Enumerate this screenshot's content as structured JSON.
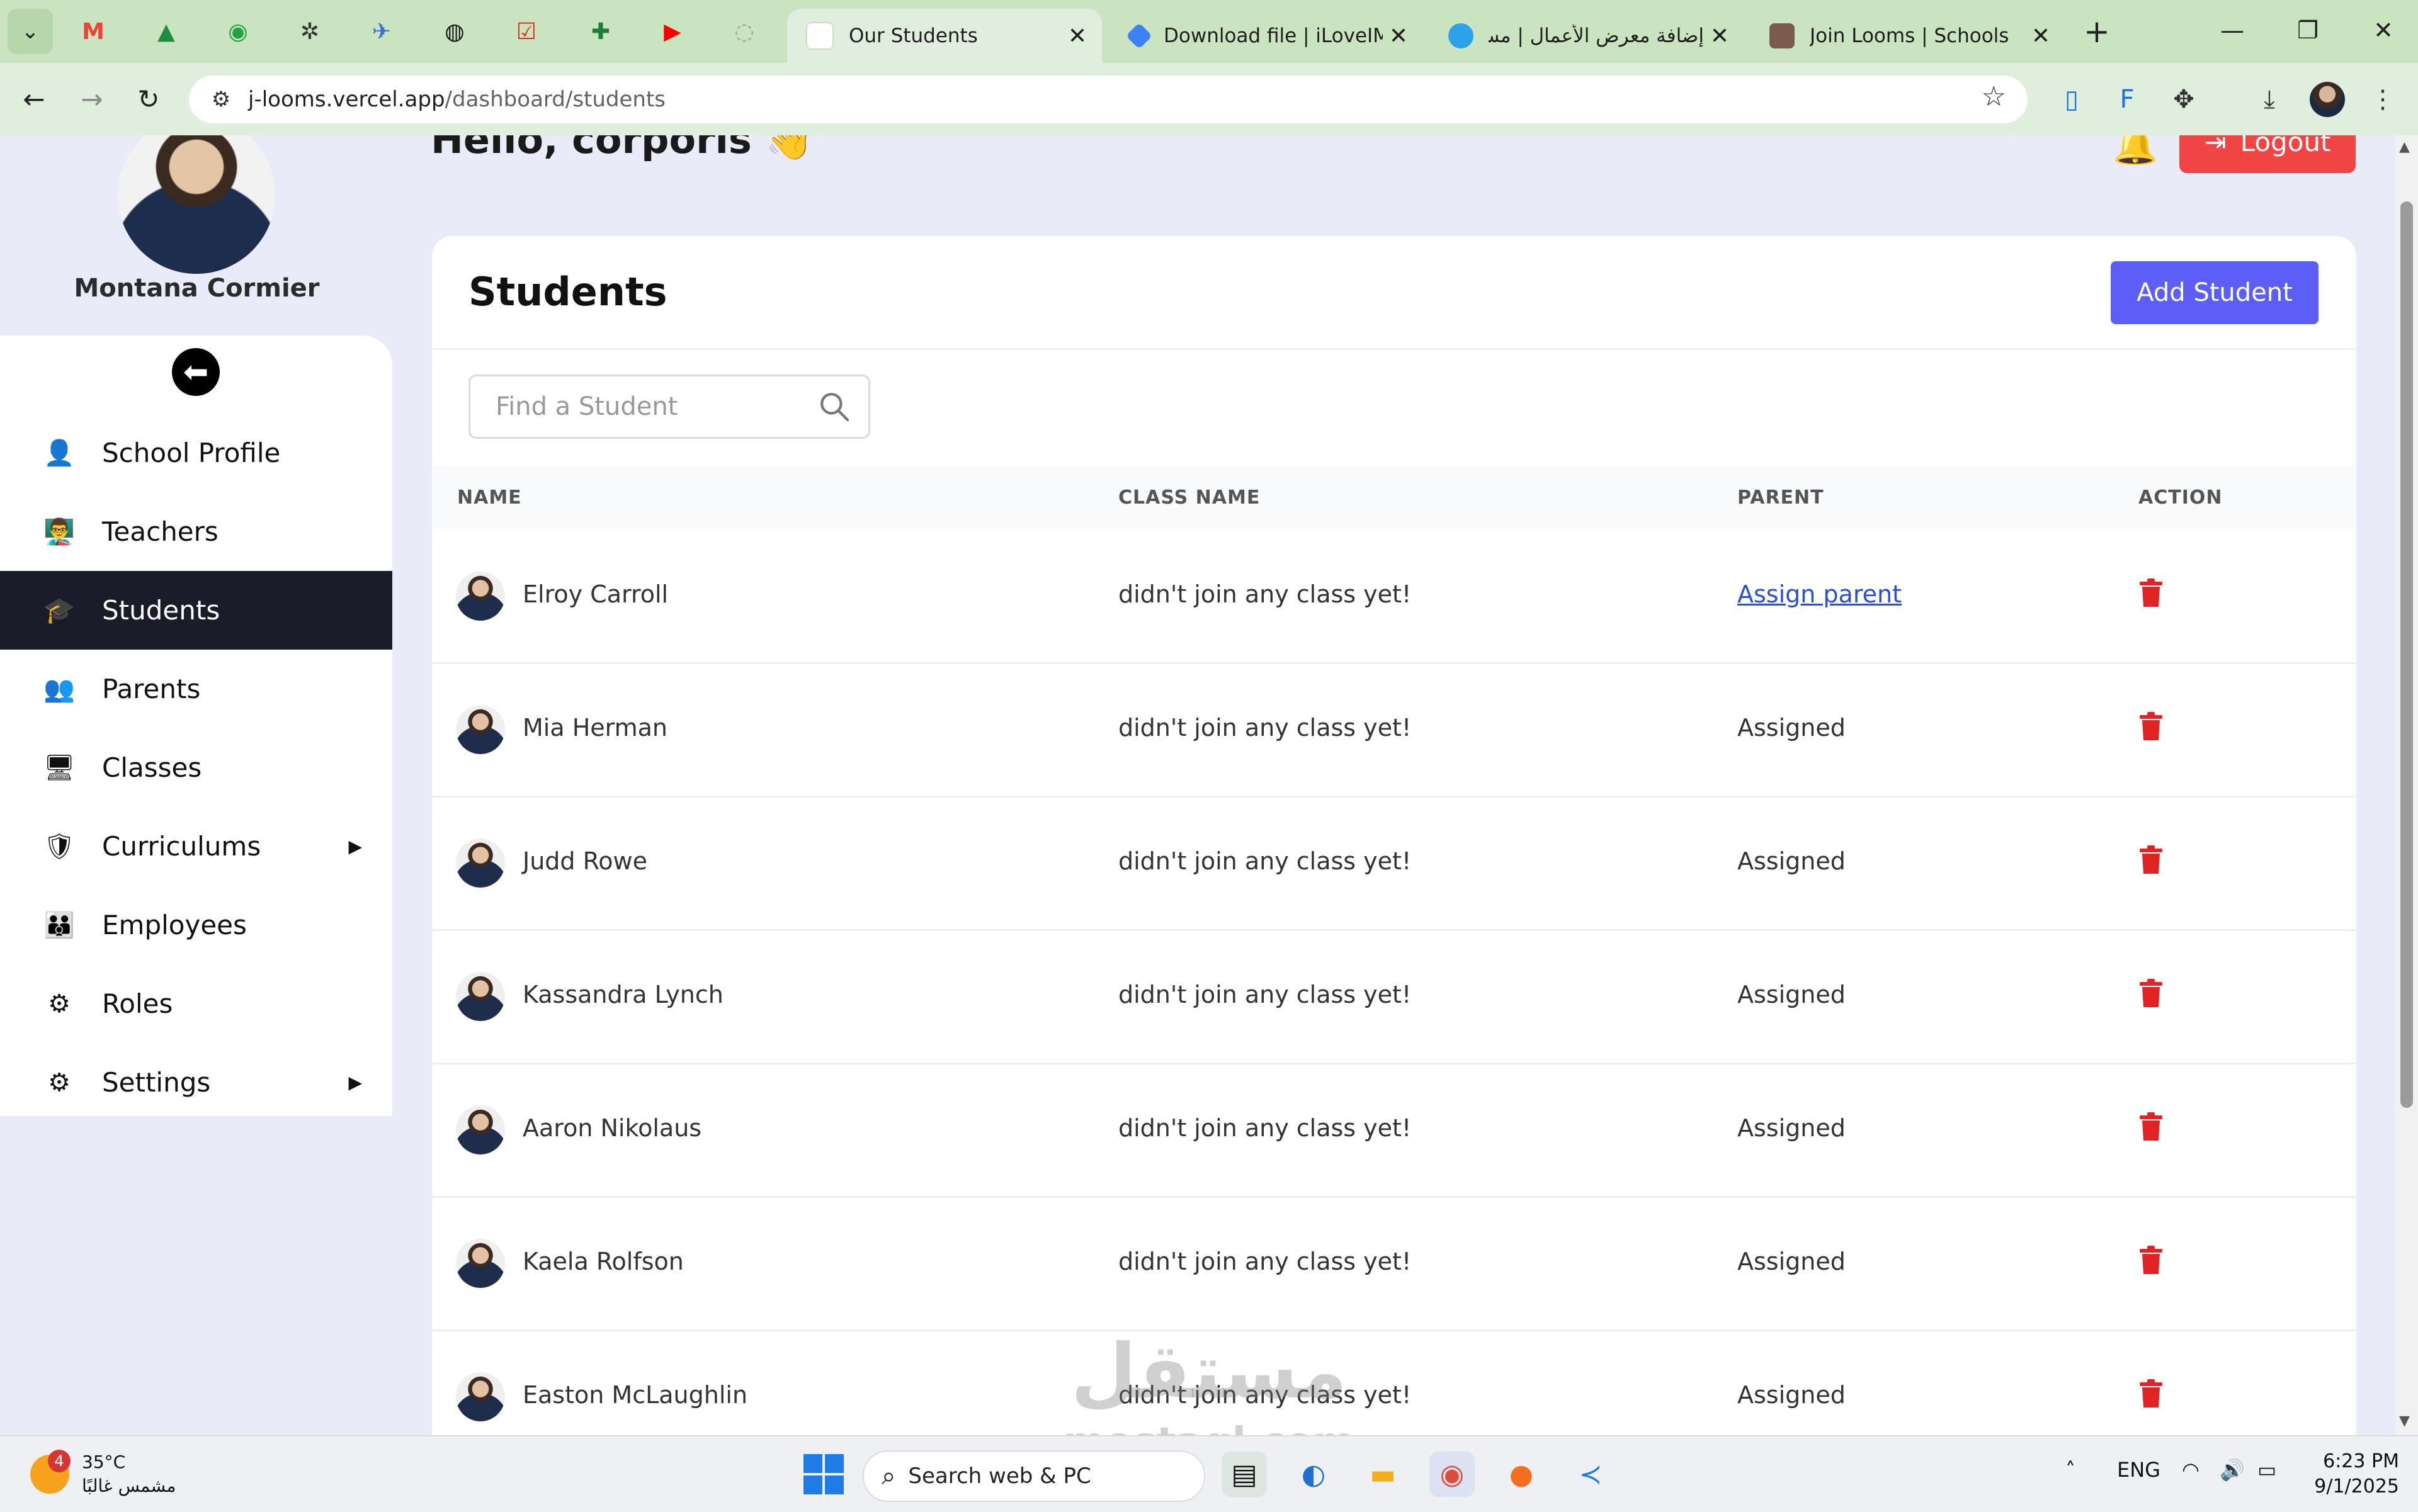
{
  "browser": {
    "tabs": [
      {
        "title": "Our Students",
        "active": true
      },
      {
        "title": "Download file | iLoveIMG",
        "active": false
      },
      {
        "title": "إضافة معرض الأعمال | مس",
        "active": false
      },
      {
        "title": "Join Looms | Schools",
        "active": false
      }
    ],
    "new_tab": "+",
    "url_host": "j-looms.vercel.app",
    "url_path": "/dashboard/students"
  },
  "user": {
    "name": "Montana Cormier",
    "greeting": "Hello, corporis 👋",
    "logout_label": "Logout"
  },
  "sidebar": {
    "items": [
      {
        "label": "School Profile",
        "icon": "person-icon",
        "glyph": "👤"
      },
      {
        "label": "Teachers",
        "icon": "chalkboard-teacher-icon",
        "glyph": "👨‍🏫"
      },
      {
        "label": "Students",
        "icon": "graduation-cap-icon",
        "glyph": "🎓"
      },
      {
        "label": "Parents",
        "icon": "people-icon",
        "glyph": "👥"
      },
      {
        "label": "Classes",
        "icon": "classroom-icon",
        "glyph": "🖥"
      },
      {
        "label": "Curriculums",
        "icon": "shield-icon",
        "glyph": "🛡"
      },
      {
        "label": "Employees",
        "icon": "users-icon",
        "glyph": "👪"
      },
      {
        "label": "Roles",
        "icon": "user-gear-icon",
        "glyph": "⚙"
      },
      {
        "label": "Settings",
        "icon": "gear-icon",
        "glyph": "⚙"
      }
    ],
    "active": "Students"
  },
  "students_card": {
    "title": "Students",
    "add_label": "Add Student",
    "search_placeholder": "Find a Student",
    "columns": [
      "NAME",
      "CLASS NAME",
      "PARENT",
      "ACTION"
    ],
    "rows": [
      {
        "name": "Elroy Carroll",
        "class": "didn't join any class yet!",
        "parent": "Assign parent",
        "link": true
      },
      {
        "name": "Mia Herman",
        "class": "didn't join any class yet!",
        "parent": "Assigned",
        "link": false
      },
      {
        "name": "Judd Rowe",
        "class": "didn't join any class yet!",
        "parent": "Assigned",
        "link": false
      },
      {
        "name": "Kassandra Lynch",
        "class": "didn't join any class yet!",
        "parent": "Assigned",
        "link": false
      },
      {
        "name": "Aaron Nikolaus",
        "class": "didn't join any class yet!",
        "parent": "Assigned",
        "link": false
      },
      {
        "name": "Kaela Rolfson",
        "class": "didn't join any class yet!",
        "parent": "Assigned",
        "link": false
      },
      {
        "name": "Easton McLaughlin",
        "class": "didn't join any class yet!",
        "parent": "Assigned",
        "link": false
      }
    ]
  },
  "watermark": {
    "line1": "مستقل",
    "line2": "mostaql.com"
  },
  "taskbar": {
    "weather_temp": "35°C",
    "weather_desc": "مشمس غالبًا",
    "weather_badge": "4",
    "search_label": "Search web & PC",
    "language": "ENG",
    "time": "6:23 PM",
    "date": "9/1/2025"
  },
  "colors": {
    "accent": "#5b5ff5",
    "logout": "#f14444",
    "active_nav": "#1b1c2a",
    "delete": "#e02424",
    "link": "#2a4fd1"
  }
}
